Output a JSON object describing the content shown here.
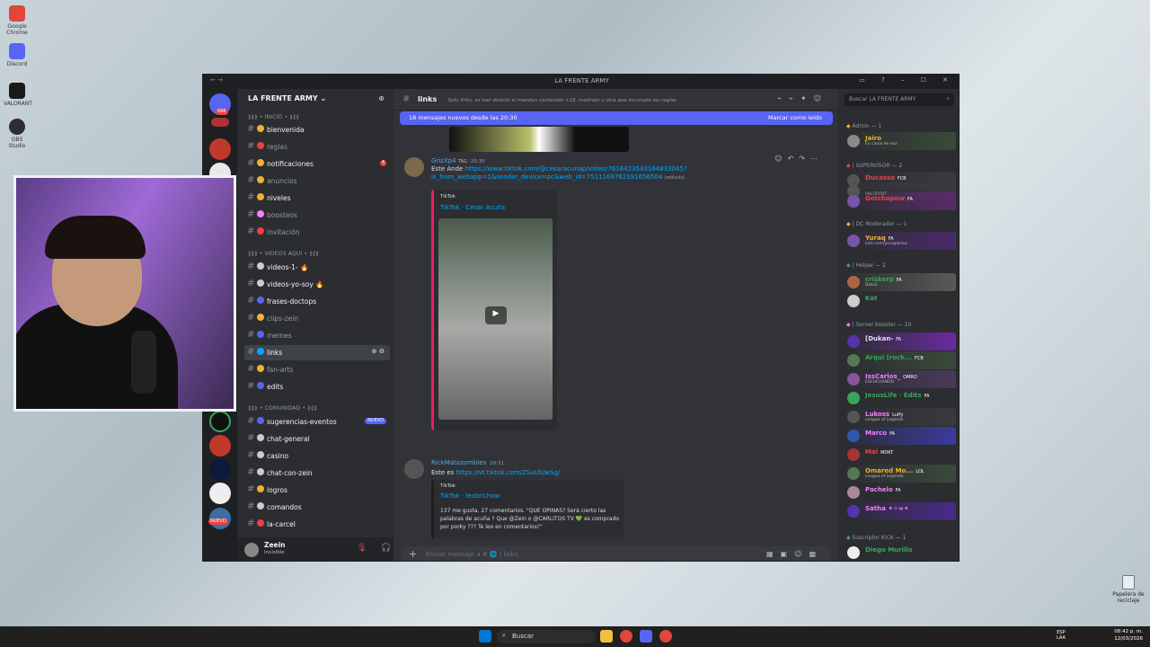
{
  "desktop": {
    "icons": [
      {
        "label": "Google Chrome",
        "color": "#e0463a"
      },
      {
        "label": "Discord",
        "color": "#5865f2"
      },
      {
        "label": "VALORANT",
        "color": "#1a1a1a"
      },
      {
        "label": "OBS Studio",
        "color": "#302e31"
      }
    ],
    "recycle": "Papelera de reciclaje"
  },
  "window": {
    "title": "LA FRENTE ARMY",
    "nav": "← →",
    "controls": "▭ ? – ☐ ✕"
  },
  "servers": {
    "badge_top": "696",
    "badge_2": "1",
    "new_label": "NUEVO"
  },
  "sidebar": {
    "server_name": "LA FRENTE ARMY",
    "categories": [
      {
        "label": "⟫⟫⟫ • INICIO • ⟪⟪⟪"
      },
      {
        "label": "⟫⟫⟫ • VIDEOS AQUI • ⟪⟪⟪"
      },
      {
        "label": "⟫⟫⟫ • COMUNIDAD • ⟪⟪⟪"
      }
    ],
    "channels": [
      {
        "label": "bienvenida",
        "bright": true,
        "emo": "#f0b232"
      },
      {
        "label": "reglas",
        "bright": false,
        "emo": "#f23f43"
      },
      {
        "label": "notificaciones",
        "bright": true,
        "emo": "#f0b232",
        "badge": "4"
      },
      {
        "label": "anuncios",
        "bright": false,
        "emo": "#f0b232"
      },
      {
        "label": "niveles",
        "bright": true,
        "emo": "#f0b232"
      },
      {
        "label": "boosteos",
        "bright": false,
        "emo": "#f47fff"
      },
      {
        "label": "invitación",
        "bright": false,
        "emo": "#f23f43"
      },
      {
        "label": "videos-1- 🔥",
        "bright": true,
        "emo": "#cccccc"
      },
      {
        "label": "videos-yo-soy 🔥",
        "bright": true,
        "emo": "#cccccc"
      },
      {
        "label": "frases-doctops",
        "bright": true,
        "emo": "#5865f2"
      },
      {
        "label": "clips-zein",
        "bright": false,
        "emo": "#f0b232"
      },
      {
        "label": "memes",
        "bright": false,
        "emo": "#5865f2"
      },
      {
        "label": "links",
        "bright": true,
        "emo": "#00a8fc",
        "selected": true
      },
      {
        "label": "fan-arts",
        "bright": false,
        "emo": "#f0b232"
      },
      {
        "label": "edits",
        "bright": true,
        "emo": "#5865f2"
      },
      {
        "label": "sugerencias-eventos",
        "bright": true,
        "emo": "#5865f2",
        "newbadge": "NUEVO"
      },
      {
        "label": "chat-general",
        "bright": true,
        "emo": "#cccccc"
      },
      {
        "label": "casino",
        "bright": true,
        "emo": "#cccccc"
      },
      {
        "label": "chat-con-zein",
        "bright": true,
        "emo": "#cccccc"
      },
      {
        "label": "logros",
        "bright": true,
        "emo": "#f0b232"
      },
      {
        "label": "comandos",
        "bright": true,
        "emo": "#cccccc"
      },
      {
        "label": "la-carcel",
        "bright": true,
        "emo": "#f23f43"
      }
    ],
    "user": {
      "name": "Zeein",
      "status": "Invisible"
    }
  },
  "channel": {
    "name": "links",
    "topic": "Solo links, es ban directo si mandan contenido +18, maltrato u otra que incumpla las reglas",
    "new_messages": "18 mensajes nuevos desde las 20:30",
    "mark_read": "Marcar como leído",
    "composer_placeholder": "Enviar mensaje a # 🌐 | links"
  },
  "messages": [
    {
      "author": "GrizXp4",
      "tag": "TAG",
      "time": "20:30",
      "text": "Este Ande",
      "link": "https://www.tiktok.com/@cesaracunap/video/7616423543164833045?is_from_webapp=1&sender_device=pc&web_id=7511169762191656504",
      "edited": "(editado)",
      "embed": {
        "provider": "TikTok",
        "title": "TikTok · César Acuña"
      }
    },
    {
      "author": "RickMatazombies",
      "time": "20:31",
      "text": "Este es",
      "link": "https://vt.tiktok.com/ZSuUbjwSg/",
      "embed": {
        "provider": "TikTok",
        "title": "TikTok · leobrichow",
        "desc": "137 me gusta, 27 comentarios. \"QUE OPINAS? Será cierto las palabras de acuña ? Que @Zein o @CARLITOS TV 💚 es comprado por porky ??? Te leo en comentarios!\""
      }
    }
  ],
  "members": {
    "search_placeholder": "Buscar LA FRENTE ARMY",
    "groups": [
      {
        "label": "Admin — 1"
      },
      {
        "label": "| SUPERVISOR — 2"
      },
      {
        "label": "| DC Moderador — 1"
      },
      {
        "label": "| Helper — 2"
      },
      {
        "label": "| Server booster — 10"
      },
      {
        "label": "Suscriptor KICK — 1"
      }
    ],
    "list": [
      {
        "name": "Jairo",
        "sub": "En canal de voz",
        "color": "#f0b232",
        "bg": "#3a4a3a",
        "av": "#8a8a8a"
      },
      {
        "name": "Ducasso",
        "sub": "",
        "tag": "FCB",
        "color": "#f23f43",
        "bg": "#3a3a3e",
        "av": "#555555"
      },
      {
        "name": "",
        "sub": "VALORANT",
        "color": "#f23f43",
        "bg": "#3a3a3e",
        "av": "#555555"
      },
      {
        "name": "Gotchapow",
        "tag": "FA",
        "color": "#f23f43",
        "bg": "#5a2a6a",
        "av": "#7755aa"
      },
      {
        "name": "Yuraq",
        "tag": "FA",
        "sub": "kick.com/yuraqlanka",
        "color": "#f0b232",
        "bg": "#4a2a6a",
        "av": "#7755aa"
      },
      {
        "name": "criskerp",
        "tag": "FA",
        "sub": "Dota2",
        "color": "#3ba55c",
        "bg": "#5a5a55",
        "av": "#aa6644"
      },
      {
        "name": "Kat",
        "color": "#3ba55c",
        "bg": "",
        "av": "#cccccc"
      },
      {
        "name": "[Dukan-",
        "tag": "FA",
        "color": "#e0e0ff",
        "bg": "#6a2aa0",
        "av": "#5533aa"
      },
      {
        "name": "Arqui [rock...",
        "tag": "FCB",
        "color": "#3ba55c",
        "bg": "#3a4a3a",
        "av": "#557755"
      },
      {
        "name": "IssCarlos_",
        "tag": "OMRO",
        "sub": "ESCUCHANDO",
        "color": "#f47fff",
        "bg": "#4a3a5a",
        "av": "#885599"
      },
      {
        "name": "JesusLife · Edits",
        "tag": "FA",
        "color": "#3ba55c",
        "bg": "",
        "av": "#3ba55c"
      },
      {
        "name": "Lukoss",
        "tag": "Luffy",
        "sub": "League of Legends",
        "color": "#f47fff",
        "bg": "#3a3a3e",
        "av": "#555555"
      },
      {
        "name": "Marco",
        "tag": "FA",
        "color": "#f47fff",
        "bg": "#3a3aa0",
        "av": "#3355aa"
      },
      {
        "name": "Mai",
        "tag": "MDKT",
        "color": "#f23f43",
        "bg": "",
        "av": "#aa3333"
      },
      {
        "name": "Omared Mo...",
        "tag": "LOL",
        "sub": "League of Legends",
        "color": "#f0b232",
        "bg": "#3a4a3a",
        "av": "#557755"
      },
      {
        "name": "Pachelo",
        "tag": "FA",
        "color": "#f47fff",
        "bg": "",
        "av": "#aa8899"
      },
      {
        "name": "Satha ✦✧≈✦",
        "color": "#f47fff",
        "bg": "#4a2a8a",
        "av": "#5533aa"
      },
      {
        "name": "Diego Murillo",
        "color": "#3ba55c",
        "bg": "",
        "av": "#eeeeee"
      }
    ]
  },
  "taskbar": {
    "search": "Buscar",
    "lang": "ESP\nLAA",
    "time": "08:42 p. m.",
    "date": "12/03/2026"
  }
}
